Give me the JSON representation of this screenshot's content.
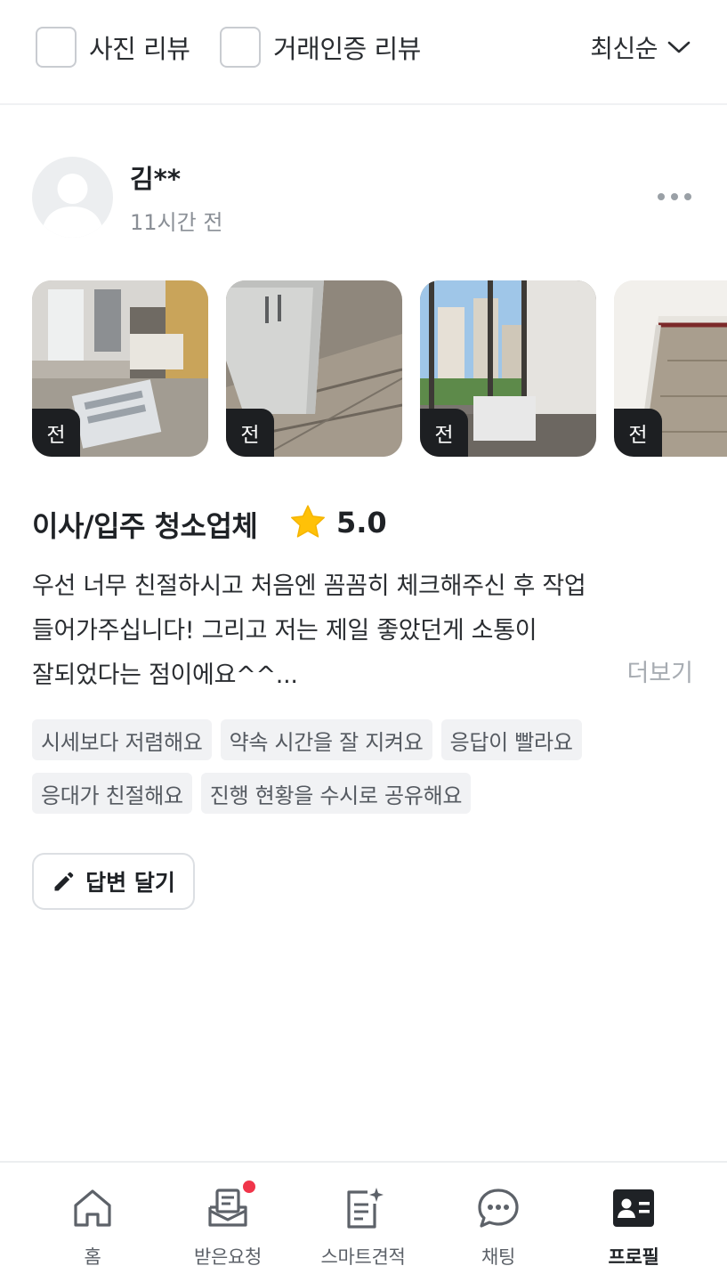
{
  "filters": {
    "photo_review": "사진 리뷰",
    "verified_review": "거래인증 리뷰",
    "sort_label": "최신순"
  },
  "review": {
    "reviewer_name": "김**",
    "time_ago": "11시간 전",
    "photos": [
      {
        "badge": "전"
      },
      {
        "badge": "전"
      },
      {
        "badge": "전"
      },
      {
        "badge": "전"
      }
    ],
    "service_title": "이사/입주 청소업체",
    "rating": "5.0",
    "rating_color": "#ffc107",
    "body_lines": [
      "우선 너무 친절하시고 처음엔 꼼꼼히 체크해주신 후 작업",
      "들어가주십니다! 그리고 저는 제일 좋았던게 소통이",
      "잘되었다는 점이에요^^..."
    ],
    "more_label": "더보기",
    "tags": [
      "시세보다 저렴해요",
      "약속 시간을 잘 지켜요",
      "응답이 빨라요",
      "응대가 친절해요",
      "진행 현황을 수시로 공유해요"
    ],
    "reply_label": "답변 달기"
  },
  "bottom_nav": {
    "items": [
      {
        "label": "홈",
        "icon": "home-icon"
      },
      {
        "label": "받은요청",
        "icon": "inbox-icon"
      },
      {
        "label": "스마트견적",
        "icon": "smart-quote-icon"
      },
      {
        "label": "채팅",
        "icon": "chat-icon"
      },
      {
        "label": "프로필",
        "icon": "profile-card-icon"
      }
    ],
    "active": "프로필",
    "notification_color": "#f0354a"
  }
}
